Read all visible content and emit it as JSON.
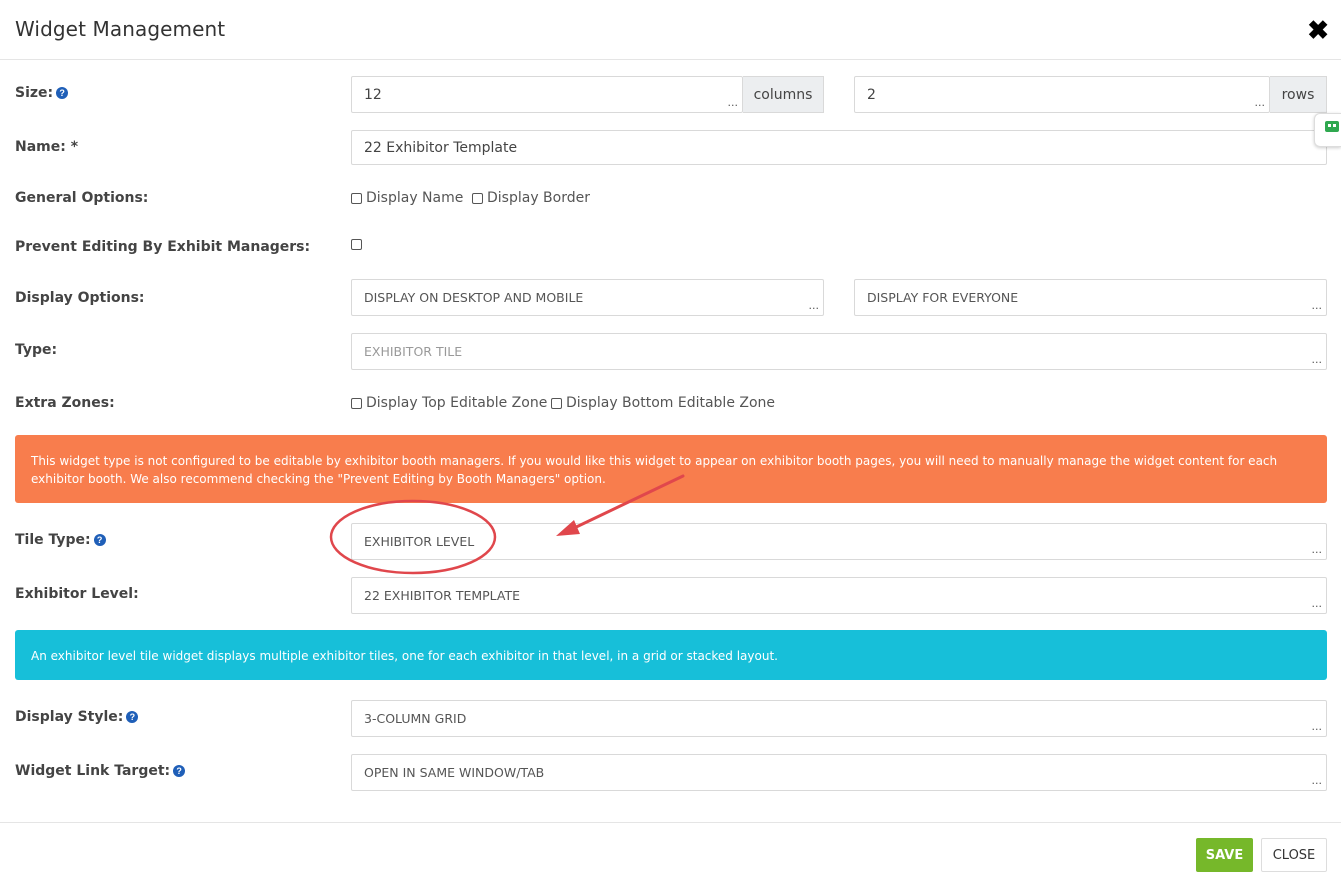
{
  "header": {
    "title": "Widget Management"
  },
  "size": {
    "label": "Size:",
    "columns_value": "12",
    "columns_addon": "columns",
    "rows_value": "2",
    "rows_addon": "rows"
  },
  "name": {
    "label": "Name: *",
    "value": "22 Exhibitor Template"
  },
  "general_options": {
    "label": "General Options:",
    "display_name": "Display Name",
    "display_border": "Display Border"
  },
  "prevent_editing": {
    "label": "Prevent Editing By Exhibit Managers:"
  },
  "display_options": {
    "label": "Display Options:",
    "device": "DISPLAY ON DESKTOP AND MOBILE",
    "audience": "DISPLAY FOR EVERYONE"
  },
  "type": {
    "label": "Type:",
    "value": "EXHIBITOR TILE"
  },
  "extra_zones": {
    "label": "Extra Zones:",
    "top": "Display Top Editable Zone",
    "bottom": "Display Bottom Editable Zone"
  },
  "warning": {
    "text": "This widget type is not configured to be editable by exhibitor booth managers. If you would like this widget to appear on exhibitor booth pages, you will need to manually manage the widget content for each exhibitor booth. We also recommend checking the \"Prevent Editing by Booth Managers\" option."
  },
  "tile_type": {
    "label": "Tile Type:",
    "value": "EXHIBITOR LEVEL"
  },
  "exhibitor_level": {
    "label": "Exhibitor Level:",
    "value": "22 EXHIBITOR TEMPLATE"
  },
  "info": {
    "text": "An exhibitor level tile widget displays multiple exhibitor tiles, one for each exhibitor in that level, in a grid or stacked layout."
  },
  "display_style": {
    "label": "Display Style:",
    "value": "3-COLUMN GRID"
  },
  "link_target": {
    "label": "Widget Link Target:",
    "value": "OPEN IN SAME WINDOW/TAB"
  },
  "footer": {
    "save": "SAVE",
    "close": "CLOSE"
  },
  "icons": {
    "close": "close-icon",
    "help": "help-icon",
    "side_tab": "chat-icon"
  },
  "colors": {
    "warning": "#f87d4d",
    "info": "#17bfd9",
    "save": "#76b82a",
    "annotation": "#e0474c"
  }
}
